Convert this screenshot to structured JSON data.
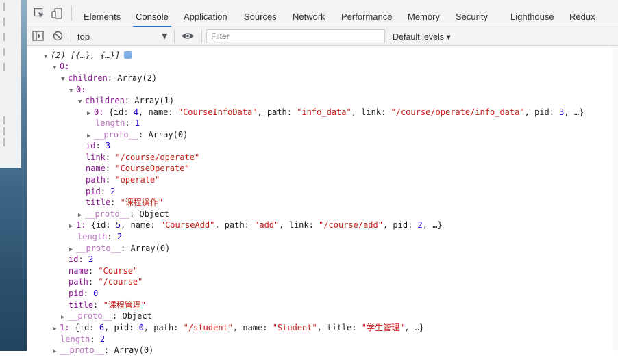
{
  "toolbar": {
    "tabs": [
      "Elements",
      "Console",
      "Application",
      "Sources",
      "Network",
      "Performance",
      "Memory",
      "Security",
      "Lighthouse",
      "Redux"
    ],
    "active_tab": "Console"
  },
  "console_bar": {
    "context": "top",
    "filter_placeholder": "Filter",
    "levels": "Default levels ▾"
  },
  "colors": {
    "accent": "#1a73e8",
    "key": "#881391",
    "string": "#c41a16",
    "number": "#1c00cf"
  },
  "log": {
    "root": "(2) [{…}, {…}]",
    "i0": "0:",
    "children_key": "children",
    "children_val": "Array(2)",
    "c0": "0:",
    "c0_children_key": "children",
    "c0_children_val": "Array(1)",
    "cc0_idx": "0:",
    "cc0_preview": [
      "{id: ",
      "4",
      ", name: ",
      "\"CourseInfoData\"",
      ", path: ",
      "\"info_data\"",
      ", link: ",
      "\"/course/operate/info_data\"",
      ", pid: ",
      "3",
      ", …}"
    ],
    "cc_length": "1",
    "cc_proto": "Array(0)",
    "c0_id": "3",
    "c0_link": "\"/course/operate\"",
    "c0_name": "\"CourseOperate\"",
    "c0_path": "\"operate\"",
    "c0_pid": "2",
    "c0_title": "\"课程操作\"",
    "c0_proto": "Object",
    "c1_idx": "1:",
    "c1_preview": [
      "{id: ",
      "5",
      ", name: ",
      "\"CourseAdd\"",
      ", path: ",
      "\"add\"",
      ", link: ",
      "\"/course/add\"",
      ", pid: ",
      "2",
      ", …}"
    ],
    "children_length": "2",
    "children_proto": "Array(0)",
    "i0_id": "2",
    "i0_name": "\"Course\"",
    "i0_path": "\"/course\"",
    "i0_pid": "0",
    "i0_title": "\"课程管理\"",
    "i0_proto": "Object",
    "i1_idx": "1:",
    "i1_preview": [
      "{id: ",
      "6",
      ", pid: ",
      "0",
      ", path: ",
      "\"/student\"",
      ", name: ",
      "\"Student\"",
      ", title: ",
      "\"学生管理\"",
      ", …}"
    ],
    "root_length": "2",
    "root_proto": "Array(0)"
  },
  "labels": {
    "id": "id",
    "name": "name",
    "path": "path",
    "link": "link",
    "pid": "pid",
    "title": "title",
    "length": "length",
    "proto": "__proto__"
  }
}
